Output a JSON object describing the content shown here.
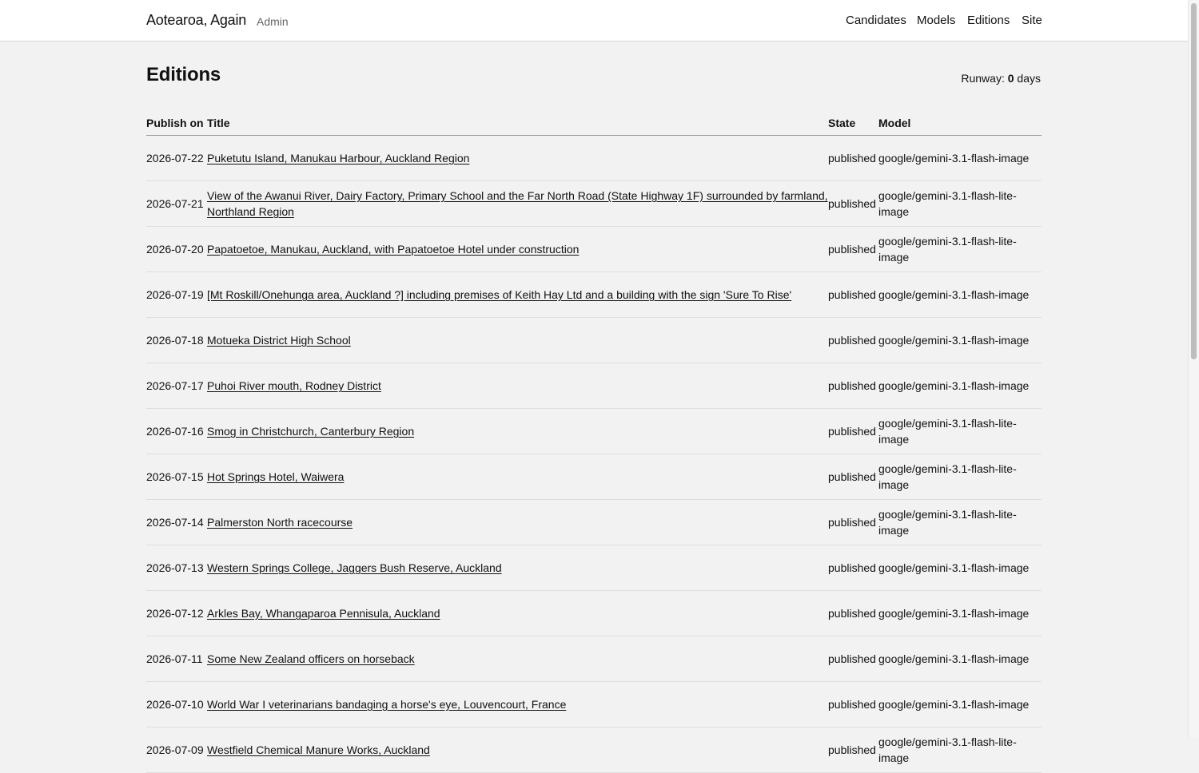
{
  "header": {
    "brand": "Aotearoa, Again",
    "section": "Admin",
    "nav": [
      "Candidates",
      "Models",
      "Editions",
      "Site"
    ]
  },
  "page": {
    "title": "Editions",
    "runway_label": "Runway:",
    "runway_value": "0",
    "runway_unit": "days"
  },
  "table": {
    "columns": [
      "Publish on",
      "Title",
      "State",
      "Model"
    ],
    "rows": [
      {
        "date": "2026-07-22",
        "title": "Puketutu Island, Manukau Harbour, Auckland Region",
        "state": "published",
        "model": "google/gemini-3.1-flash-image"
      },
      {
        "date": "2026-07-21",
        "title": "View of the Awanui River, Dairy Factory, Primary School and the Far North Road (State Highway 1F) surrounded by farmland, Northland Region",
        "state": "published",
        "model": "google/gemini-3.1-flash-lite-image"
      },
      {
        "date": "2026-07-20",
        "title": "Papatoetoe, Manukau, Auckland, with Papatoetoe Hotel under construction",
        "state": "published",
        "model": "google/gemini-3.1-flash-lite-image"
      },
      {
        "date": "2026-07-19",
        "title": "[Mt Roskill/Onehunga area, Auckland ?] including premises of Keith Hay Ltd and a building with the sign 'Sure To Rise'",
        "state": "published",
        "model": "google/gemini-3.1-flash-image"
      },
      {
        "date": "2026-07-18",
        "title": "Motueka District High School",
        "state": "published",
        "model": "google/gemini-3.1-flash-image"
      },
      {
        "date": "2026-07-17",
        "title": "Puhoi River mouth, Rodney District",
        "state": "published",
        "model": "google/gemini-3.1-flash-image"
      },
      {
        "date": "2026-07-16",
        "title": "Smog in Christchurch, Canterbury Region",
        "state": "published",
        "model": "google/gemini-3.1-flash-lite-image"
      },
      {
        "date": "2026-07-15",
        "title": "Hot Springs Hotel, Waiwera",
        "state": "published",
        "model": "google/gemini-3.1-flash-lite-image"
      },
      {
        "date": "2026-07-14",
        "title": "Palmerston North racecourse",
        "state": "published",
        "model": "google/gemini-3.1-flash-lite-image"
      },
      {
        "date": "2026-07-13",
        "title": "Western Springs College, Jaggers Bush Reserve, Auckland",
        "state": "published",
        "model": "google/gemini-3.1-flash-image"
      },
      {
        "date": "2026-07-12",
        "title": "Arkles Bay, Whangaparoa Pennisula, Auckland",
        "state": "published",
        "model": "google/gemini-3.1-flash-image"
      },
      {
        "date": "2026-07-11",
        "title": "Some New Zealand officers on horseback",
        "state": "published",
        "model": "google/gemini-3.1-flash-image"
      },
      {
        "date": "2026-07-10",
        "title": "World War I veterinarians bandaging a horse's eye, Louvencourt, France",
        "state": "published",
        "model": "google/gemini-3.1-flash-image"
      },
      {
        "date": "2026-07-09",
        "title": "Westfield Chemical Manure Works, Auckland",
        "state": "published",
        "model": "google/gemini-3.1-flash-lite-image"
      }
    ]
  }
}
